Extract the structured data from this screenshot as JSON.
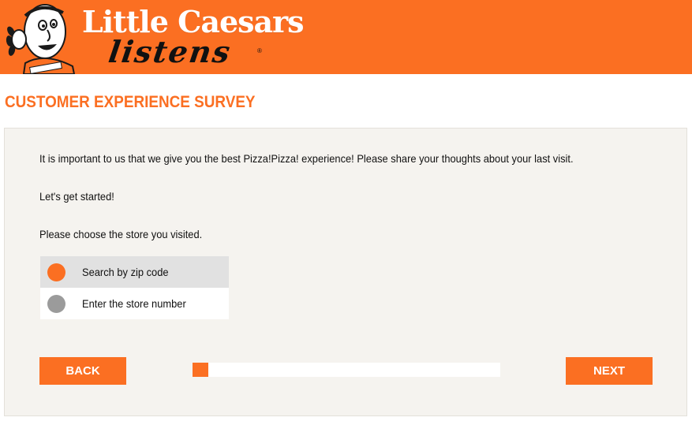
{
  "header": {
    "brand_name": "Little Caesars",
    "brand_tagline": "listens",
    "brand_reg": "®",
    "mascot_icon": "little-caesar-mascot-icon",
    "accent_color": "#fb6f22"
  },
  "survey": {
    "title": "CUSTOMER EXPERIENCE SURVEY",
    "intro": "It is important to us that we give you the best Pizza!Pizza! experience! Please share your thoughts about your last visit.",
    "start": "Let's get started!",
    "question": "Please choose the store you visited.",
    "options": [
      {
        "label": "Search by zip code",
        "selected": true
      },
      {
        "label": "Enter the store number",
        "selected": false
      }
    ],
    "back_label": "BACK",
    "next_label": "NEXT",
    "progress_fraction": 0.05
  }
}
